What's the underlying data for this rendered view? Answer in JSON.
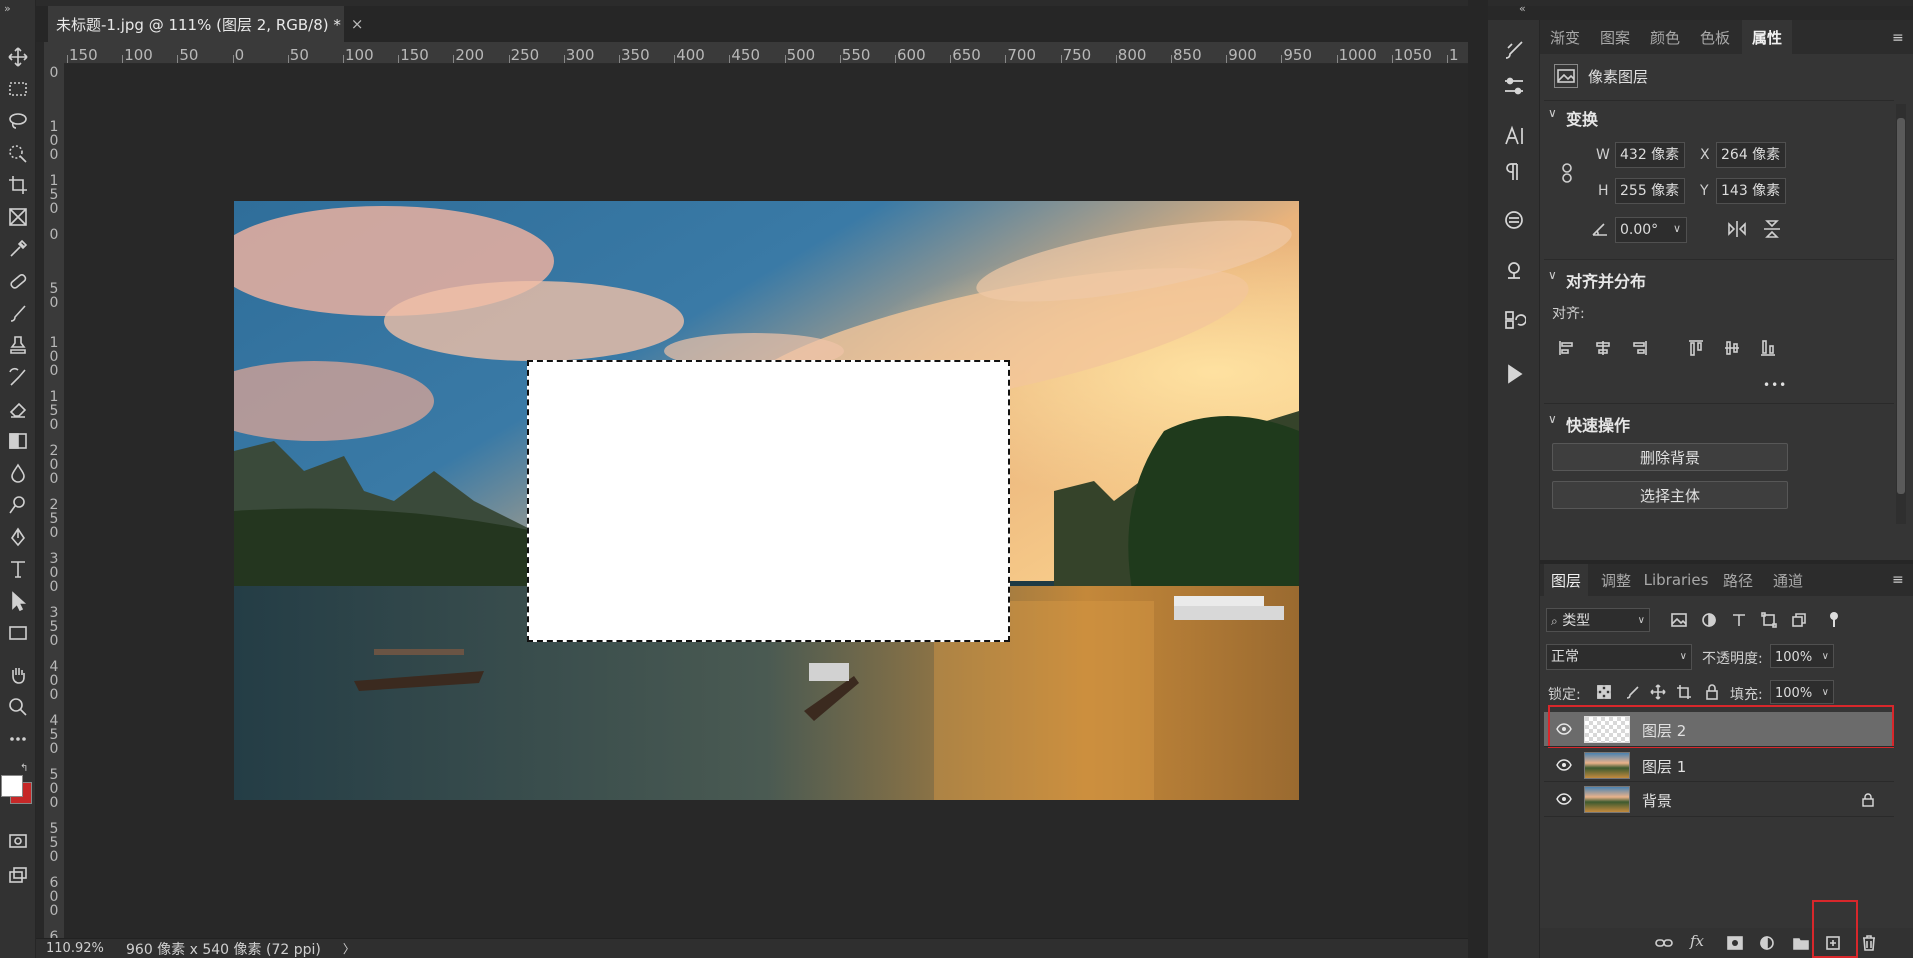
{
  "document_tab": {
    "title": "未标题-1.jpg @ 111% (图层 2, RGB/8) *",
    "close": "×"
  },
  "ruler": {
    "h_labels": [
      "150",
      "100",
      "50",
      "0",
      "50",
      "100",
      "150",
      "200",
      "250",
      "300",
      "350",
      "400",
      "450",
      "500",
      "550",
      "600",
      "650",
      "700",
      "750",
      "800",
      "850",
      "900",
      "950",
      "1000",
      "1050",
      "1"
    ],
    "v_labels": [
      "0",
      "1\n0\n0",
      "1\n5\n0",
      "0",
      "5\n0",
      "1\n0\n0",
      "1\n5\n0",
      "2\n0\n0",
      "2\n5\n0",
      "3\n0\n0",
      "3\n5\n0",
      "4\n0\n0",
      "4\n5\n0",
      "5\n0\n0",
      "5\n5\n0",
      "6\n0\n0",
      "6"
    ]
  },
  "status_bar": {
    "zoom": "110.92%",
    "doc_info": "960 像素 x 540 像素 (72 ppi)",
    "arrow": "〉"
  },
  "panel_tabs": {
    "items": [
      "渐变",
      "图案",
      "颜色",
      "色板",
      "属性"
    ],
    "active": "属性"
  },
  "properties": {
    "layer_type": "像素图层",
    "transform_title": "变换",
    "w_label": "W",
    "w_value": "432 像素",
    "x_label": "X",
    "x_value": "264 像素",
    "h_label": "H",
    "h_value": "255 像素",
    "y_label": "Y",
    "y_value": "143 像素",
    "angle_value": "0.00°",
    "align_title": "对齐并分布",
    "align_label": "对齐:",
    "more": "•••",
    "quick_title": "快速操作",
    "remove_bg": "删除背景",
    "select_subject": "选择主体"
  },
  "layers_panel": {
    "tabs": [
      "图层",
      "调整",
      "Libraries",
      "路径",
      "通道"
    ],
    "active_tab": "图层",
    "filter_kind": "类型",
    "blend_mode": "正常",
    "opacity_label": "不透明度:",
    "opacity_value": "100%",
    "lock_label": "锁定:",
    "fill_label": "填充:",
    "fill_value": "100%",
    "layers": [
      {
        "name": "图层 2",
        "selected": true,
        "thumb": "transparent"
      },
      {
        "name": "图层 1",
        "selected": false,
        "thumb": "landscape"
      },
      {
        "name": "背景",
        "selected": false,
        "thumb": "landscape",
        "locked": true
      }
    ]
  },
  "collapse_left": "»",
  "collapse_right": "«",
  "colors": {
    "highlight": "#d8272b",
    "panel_bg": "#353535",
    "selected_layer": "#6b6b6b"
  }
}
